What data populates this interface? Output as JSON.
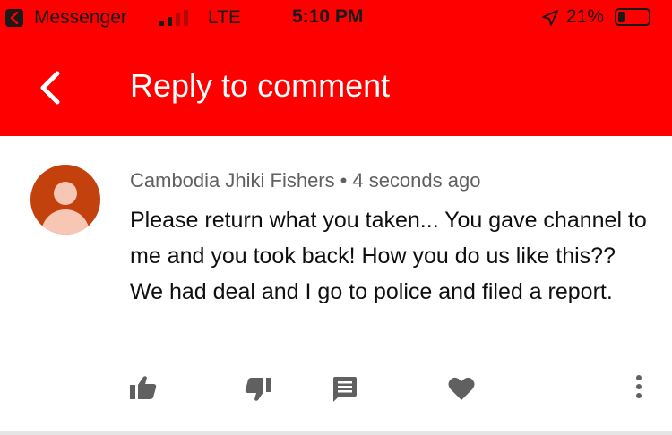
{
  "status_bar": {
    "back_app": "Messenger",
    "network": "LTE",
    "time": "5:10 PM",
    "battery_percent": "21%",
    "battery_level": 0.21,
    "signal_bars_active": 2,
    "signal_bars_total": 4,
    "icons": [
      "back-arrow-icon",
      "signal-bars-icon",
      "location-arrow-icon",
      "battery-icon"
    ]
  },
  "app_bar": {
    "title": "Reply to comment",
    "back_icon": "chevron-left-icon"
  },
  "comment": {
    "author": "Cambodia Jhiki Fishers",
    "separator": "•",
    "time_ago": "4 seconds ago",
    "text": "Please return what you taken... You gave channel to me and you took back! How you do us like this?? We had deal and I go to police and filed a report.",
    "avatar_icon": "default-user-avatar-icon",
    "actions": [
      "thumbs-up-icon",
      "thumbs-down-icon",
      "reply-comment-icon",
      "heart-icon",
      "more-vert-icon"
    ]
  },
  "colors": {
    "brand_red": "#ff0000",
    "text_primary": "#0f0f0f",
    "text_secondary": "#606060",
    "icon_gray": "#606060",
    "avatar_bg": "#c2410c",
    "avatar_fg": "#f7c6b4"
  }
}
